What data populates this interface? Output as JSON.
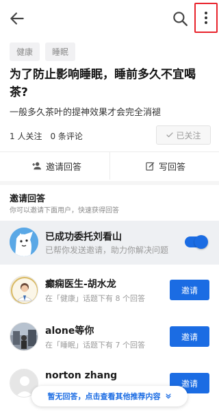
{
  "header": {
    "back_icon": "arrow-left-icon",
    "search_icon": "search-icon",
    "more_icon": "more-vertical-icon",
    "highlight_color": "#e8222b"
  },
  "question": {
    "tags": [
      "健康",
      "睡眠"
    ],
    "title": "为了防止影响睡眠，睡前多久不宜喝茶?",
    "description": "一般多久茶叶的提神效果才会完全消褪",
    "followers": "1 人关注",
    "comments": "0 条评论",
    "follow_label": "已关注"
  },
  "actions": {
    "invite_label": "邀请回答",
    "write_label": "写回答"
  },
  "invite": {
    "title": "邀请回答",
    "subtitle": "你可以邀请下面用户，快速获得回答",
    "delegate": {
      "name": "已成功委托刘看山",
      "desc": "已帮你发送邀请，助力你解决问题",
      "toggle_on": true
    },
    "users": [
      {
        "name": "癫痫医生-胡水龙",
        "desc": "在「健康」话题下有 8 个回答",
        "button": "邀请"
      },
      {
        "name": "alone等你",
        "desc": "在「睡眠」话题下有 7 个回答",
        "button": "邀请"
      },
      {
        "name": "norton zhang",
        "desc": "",
        "button": "邀请"
      }
    ]
  },
  "toast": {
    "text": "暂无回答，点击查看其他推荐内容",
    "icon": "chevron-double-down-icon"
  },
  "colors": {
    "accent": "#1b6ce3",
    "muted": "#9a9a9a"
  }
}
